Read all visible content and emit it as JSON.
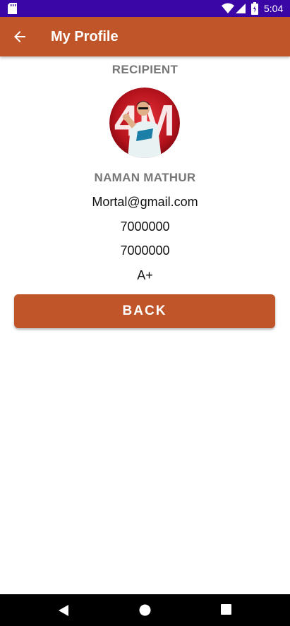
{
  "status_bar": {
    "time": "5:04"
  },
  "app_bar": {
    "title": "My Profile"
  },
  "profile": {
    "role": "RECIPIENT",
    "avatar_text": "4M",
    "name": "NAMAN MATHUR",
    "email": "Mortal@gmail.com",
    "phone_1": "7000000",
    "phone_2": "7000000",
    "blood_group": "A+"
  },
  "actions": {
    "back_label": "BACK"
  },
  "colors": {
    "status_bar": "#3a06a6",
    "primary": "#c0552a",
    "label_gray": "#777777"
  },
  "icons": {
    "status": [
      "sd-card-icon",
      "wifi-icon",
      "cell-signal-icon",
      "battery-icon"
    ],
    "app_bar": "arrow-back-icon",
    "nav": [
      "nav-back-icon",
      "nav-home-icon",
      "nav-recents-icon"
    ]
  }
}
